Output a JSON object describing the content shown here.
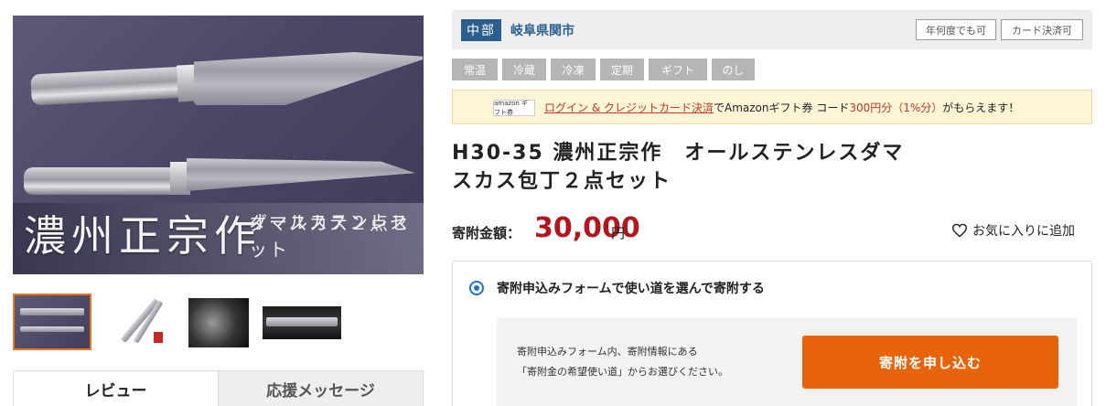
{
  "product_image": {
    "overlay_title": "濃州正宗作",
    "overlay_sub_line1": "オールステンレス",
    "overlay_sub_line2": "ダマスカス２点セット"
  },
  "thumbnails": [
    {
      "name": "thumbnail-1"
    },
    {
      "name": "thumbnail-2"
    },
    {
      "name": "thumbnail-3"
    },
    {
      "name": "thumbnail-4"
    }
  ],
  "tabs": [
    {
      "label": "レビュー",
      "active": true
    },
    {
      "label": "応援メッセージ",
      "active": false
    }
  ],
  "region": {
    "badge": "中部",
    "city": "岐阜県関市",
    "pills": [
      "年何度でも可",
      "カード決済可"
    ]
  },
  "tags": [
    "常温",
    "冷蔵",
    "冷凍",
    "定期",
    "ギフト",
    "のし"
  ],
  "promo": {
    "logo_text": "amazon ギフト券",
    "link_text": "ログイン & クレジットカード決済",
    "text_mid": "でAmazonギフト券 コード",
    "highlight": "300円分（1%分）",
    "text_end": "がもらえます！"
  },
  "product": {
    "title_line1": "H30-35 濃州正宗作　オールステンレスダマ",
    "title_line2": "スカス包丁２点セット",
    "price_label": "寄附金額：",
    "price_value": "30,000",
    "price_unit": "円",
    "favorite_label": "お気に入りに追加"
  },
  "donation": {
    "option_label": "寄附申込みフォームで使い道を選んで寄附する",
    "description_line1": "寄附申込みフォーム内、寄附情報にある",
    "description_line2": "「寄附金の希望使い道」からお選びください。",
    "button_label": "寄附を申し込む"
  },
  "colors": {
    "accent_orange": "#e8640c",
    "region_blue": "#2b5f8e",
    "price_red": "#b3161d",
    "radio_blue": "#1a73c8"
  }
}
